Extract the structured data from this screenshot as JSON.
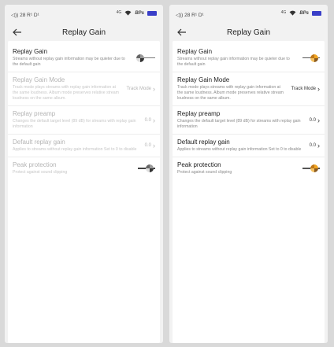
{
  "status": {
    "left_text": "◁)) 28 R¹ D¹",
    "network": "4G",
    "bps": "BPs"
  },
  "header": {
    "title": "Replay Gain"
  },
  "settings": [
    {
      "title": "Replay Gain",
      "desc": "Streams without replay gain information may be quieter due to the default gain",
      "value": ""
    },
    {
      "title": "Replay Gain Mode",
      "desc": "Track mode plays streams with replay gain information at the same loudness. Album mode preserves relative stream loudness on the same album.",
      "value": "Track Mode"
    },
    {
      "title": "Replay preamp",
      "desc": "Changes the default target level (89 dB) for streams with replay gain information",
      "value": "0.0"
    },
    {
      "title": "Default replay gain",
      "desc": "Applies to streams without replay gain information Set to 0 to disable",
      "value": "0.0"
    },
    {
      "title": "Peak protection",
      "desc": "Protect against sound clipping",
      "value": ""
    }
  ]
}
